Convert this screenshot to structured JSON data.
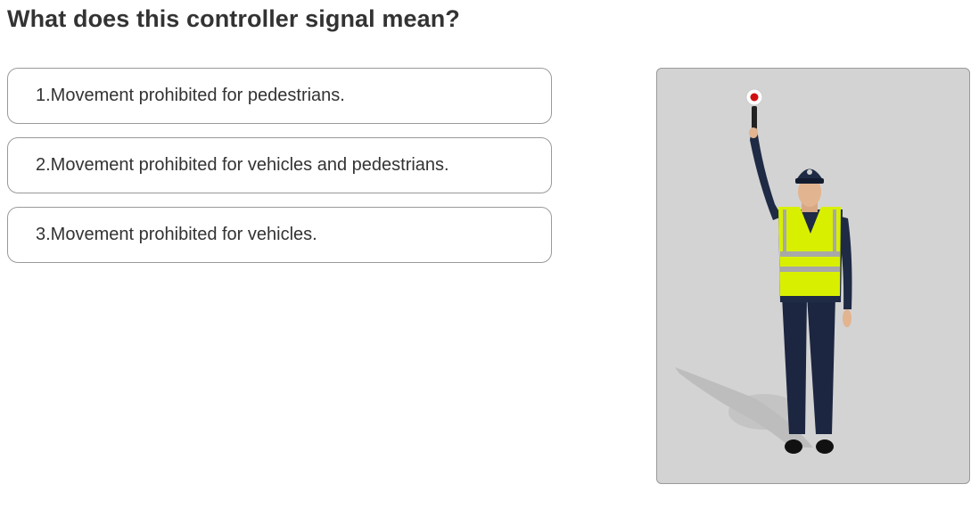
{
  "question": {
    "title": "What does this controller signal mean?"
  },
  "answers": [
    {
      "label": "1.Movement prohibited for pedestrians."
    },
    {
      "label": "2.Movement prohibited for vehicles and pedestrians."
    },
    {
      "label": "3.Movement prohibited for vehicles."
    }
  ],
  "illustration": {
    "subject": "traffic controller with raised arm holding signal baton",
    "colors": {
      "background": "#d3d3d3",
      "vest": "#d8f000",
      "reflective_stripe": "#a8a8a8",
      "uniform": "#1f2a44",
      "baton_disc": "#ffffff",
      "baton_dot": "#d01010"
    }
  }
}
